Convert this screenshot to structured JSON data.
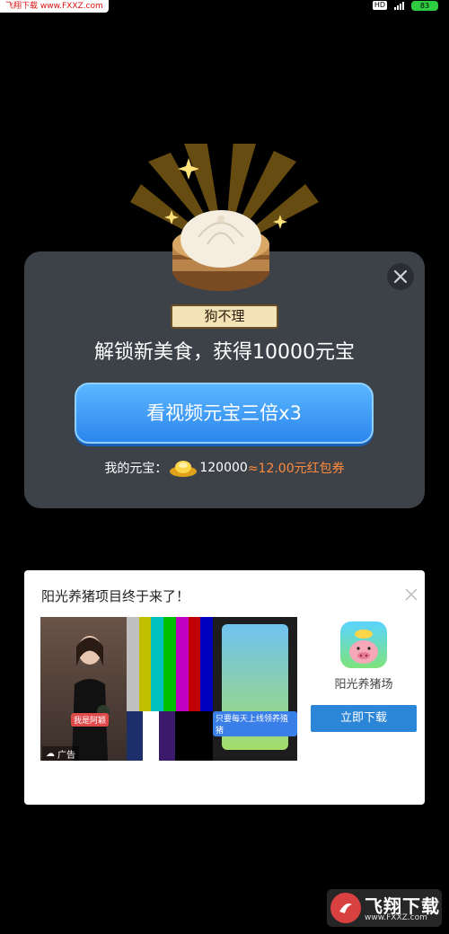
{
  "status_bar": {
    "watermark": "飞翔下载 www.FXXZ.com",
    "hd": "HD",
    "battery": "83"
  },
  "reward_card": {
    "food_name": "狗不理",
    "headline": "解锁新美食，获得10000元宝",
    "video_button": "看视频元宝三倍x3",
    "balance_label": "我的元宝：",
    "balance_value": "120000",
    "balance_equiv": "≈12.00元红包券",
    "icons": [
      "close-icon",
      "steamed-bun-icon",
      "gold-ingot-icon",
      "sparkle-icon"
    ]
  },
  "ad_card": {
    "title": "阳光养猪项目终于来了！",
    "badge": "广告",
    "subtitle_left": "我是阿颖",
    "subtitle_right": "只要每天上线领养殖猪",
    "app_name": "阳光养猪场",
    "download_button": "立即下载"
  },
  "watermark_bottom": {
    "brand": "飞翔下载",
    "url": "www.FXXZ.com"
  },
  "colors": {
    "background": "#000000",
    "card": "#3d4249",
    "button_blue": "#2b86ee",
    "accent_orange": "#ff8a3d",
    "download_blue": "#2c86d8"
  }
}
